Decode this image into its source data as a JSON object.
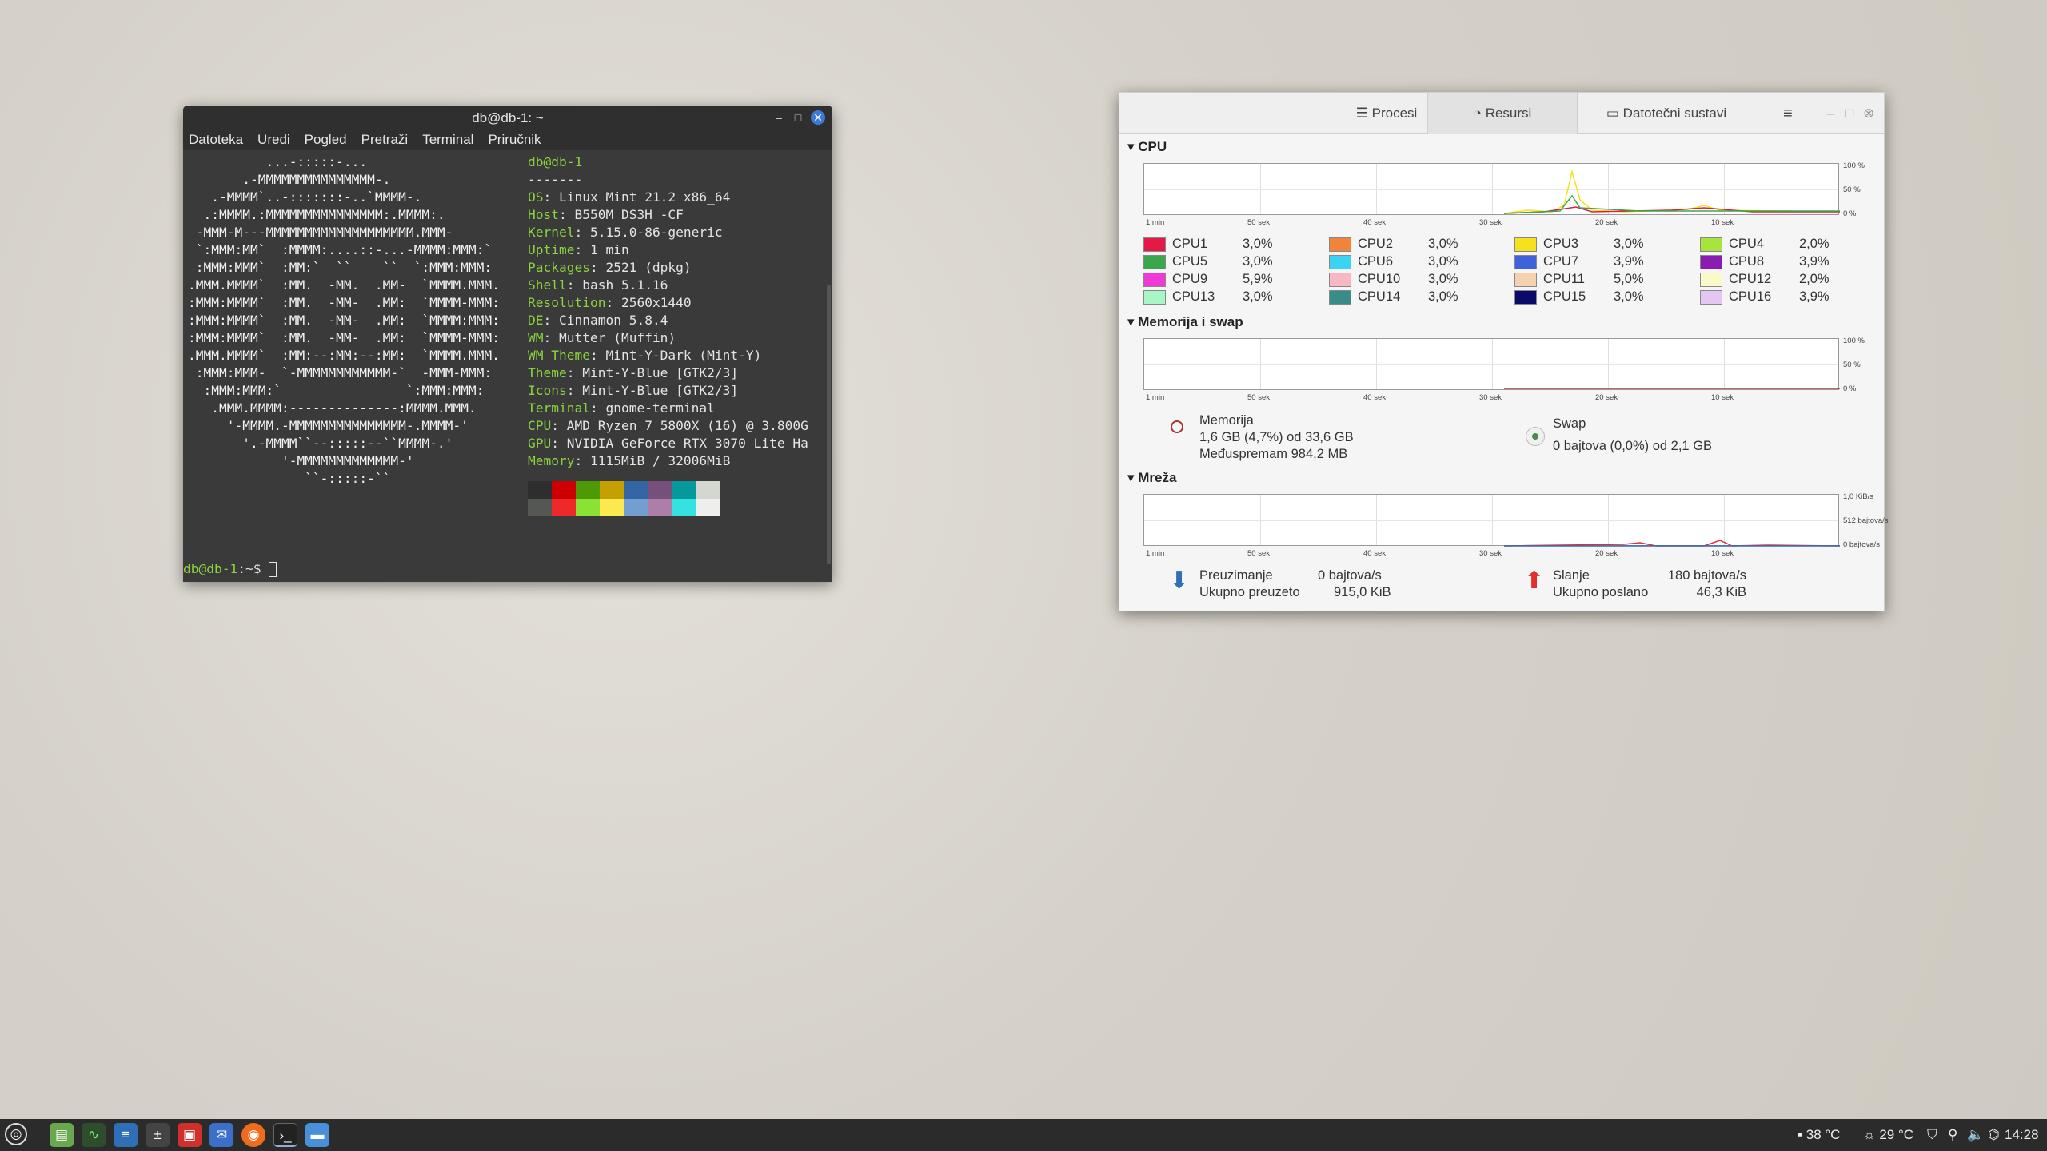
{
  "terminal": {
    "title": "db@db-1: ~",
    "menu": [
      "Datoteka",
      "Uredi",
      "Pogled",
      "Pretraži",
      "Terminal",
      "Priručnik"
    ],
    "ascii_art": [
      "          ...-:::::-...",
      "       .-MMMMMMMMMMMMMMM-.",
      "   .-MMMM`..-:::::::-..`MMMM-.",
      "  .:MMMM.:MMMMMMMMMMMMMMM:.MMMM:.",
      " -MMM-M---MMMMMMMMMMMMMMMMMMM.MMM-",
      " `:MMM:MM`  :MMMM:....::-...-MMMM:MMM:`",
      " :MMM:MMM`  :MM:`  ``    ``  `:MMM:MMM:",
      ".MMM.MMMM`  :MM.  -MM.  .MM-  `MMMM.MMM.",
      ":MMM:MMMM`  :MM.  -MM-  .MM:  `MMMM-MMM:",
      ":MMM:MMMM`  :MM.  -MM-  .MM:  `MMMM:MMM:",
      ":MMM:MMMM`  :MM.  -MM-  .MM:  `MMMM-MMM:",
      ".MMM.MMMM`  :MM:--:MM:--:MM:  `MMMM.MMM.",
      " :MMM:MMM-  `-MMMMMMMMMMMM-`  -MMM-MMM:",
      "  :MMM:MMM:`                `:MMM:MMM:",
      "   .MMM.MMMM:--------------:MMMM.MMM.",
      "     '-MMMM.-MMMMMMMMMMMMMMM-.MMMM-'",
      "       '.-MMMM``--:::::--``MMMM-.'",
      "            '-MMMMMMMMMMMMM-'",
      "               ``-:::::-``"
    ],
    "user_host": "db@db-1",
    "separator": "-------",
    "info": [
      {
        "k": "OS",
        "v": "Linux Mint 21.2 x86_64"
      },
      {
        "k": "Host",
        "v": "B550M DS3H -CF"
      },
      {
        "k": "Kernel",
        "v": "5.15.0-86-generic"
      },
      {
        "k": "Uptime",
        "v": "1 min"
      },
      {
        "k": "Packages",
        "v": "2521 (dpkg)"
      },
      {
        "k": "Shell",
        "v": "bash 5.1.16"
      },
      {
        "k": "Resolution",
        "v": "2560x1440"
      },
      {
        "k": "DE",
        "v": "Cinnamon 5.8.4"
      },
      {
        "k": "WM",
        "v": "Mutter (Muffin)"
      },
      {
        "k": "WM Theme",
        "v": "Mint-Y-Dark (Mint-Y)"
      },
      {
        "k": "Theme",
        "v": "Mint-Y-Blue [GTK2/3]"
      },
      {
        "k": "Icons",
        "v": "Mint-Y-Blue [GTK2/3]"
      },
      {
        "k": "Terminal",
        "v": "gnome-terminal"
      },
      {
        "k": "CPU",
        "v": "AMD Ryzen 7 5800X (16) @ 3.800G"
      },
      {
        "k": "GPU",
        "v": "NVIDIA GeForce RTX 3070 Lite Ha"
      },
      {
        "k": "Memory",
        "v": "1115MiB / 32006MiB"
      }
    ],
    "palette_top": [
      "#2e2e2e",
      "#cc0000",
      "#4e9a06",
      "#c4a000",
      "#3465a4",
      "#75507b",
      "#06989a",
      "#d3d7cf"
    ],
    "palette_bottom": [
      "#555753",
      "#ef2929",
      "#8ae234",
      "#fce94f",
      "#729fcf",
      "#ad7fa8",
      "#34e2e2",
      "#eeeeec"
    ],
    "prompt_user": "db@db-1",
    "prompt_rest": ":~$ "
  },
  "monitor": {
    "tabs": [
      "Procesi",
      "Resursi",
      "Datotečni sustavi"
    ],
    "cpu_title": "CPU",
    "mem_title": "Memorija i swap",
    "net_title": "Mreža",
    "time_ticks": [
      "1 min",
      "50 sek",
      "40 sek",
      "30 sek",
      "20 sek",
      "10 sek"
    ],
    "pct_ticks": [
      "100 %",
      "50 %",
      "0 %"
    ],
    "net_ticks": [
      "1,0 KiB/s",
      "512 bajtova/s",
      "0 bajtova/s"
    ],
    "cpus": [
      {
        "name": "CPU1",
        "pct": "3,0%",
        "color": "#e31a47"
      },
      {
        "name": "CPU2",
        "pct": "3,0%",
        "color": "#f0843a"
      },
      {
        "name": "CPU3",
        "pct": "3,0%",
        "color": "#f6e11d"
      },
      {
        "name": "CPU4",
        "pct": "2,0%",
        "color": "#a8e43e"
      },
      {
        "name": "CPU5",
        "pct": "3,0%",
        "color": "#3aa84a"
      },
      {
        "name": "CPU6",
        "pct": "3,0%",
        "color": "#3ad3f0"
      },
      {
        "name": "CPU7",
        "pct": "3,9%",
        "color": "#3d62dc"
      },
      {
        "name": "CPU8",
        "pct": "3,9%",
        "color": "#8b1cb0"
      },
      {
        "name": "CPU9",
        "pct": "5,9%",
        "color": "#f03ad8"
      },
      {
        "name": "CPU10",
        "pct": "3,0%",
        "color": "#f7b8c4"
      },
      {
        "name": "CPU11",
        "pct": "5,0%",
        "color": "#f6d1b0"
      },
      {
        "name": "CPU12",
        "pct": "2,0%",
        "color": "#fafac8"
      },
      {
        "name": "CPU13",
        "pct": "3,0%",
        "color": "#a8f5c6"
      },
      {
        "name": "CPU14",
        "pct": "3,0%",
        "color": "#3a8c8a"
      },
      {
        "name": "CPU15",
        "pct": "3,0%",
        "color": "#0a0a6a"
      },
      {
        "name": "CPU16",
        "pct": "3,9%",
        "color": "#e4c6f3"
      }
    ],
    "memory": {
      "label": "Memorija",
      "used": "1,6 GB (4,7%) od 33,6 GB",
      "cache": "Međuspremam 984,2 MB"
    },
    "swap": {
      "label": "Swap",
      "used": "0 bajtova (0,0%) od 2,1 GB"
    },
    "net": {
      "down_label": "Preuzimanje",
      "down_rate": "0 bajtova/s",
      "down_total_label": "Ukupno preuzeto",
      "down_total": "915,0 KiB",
      "up_label": "Slanje",
      "up_rate": "180 bajtova/s",
      "up_total_label": "Ukupno poslano",
      "up_total": "46,3 KiB"
    }
  },
  "panel": {
    "apps": [
      "menu-icon",
      "software-icon",
      "system-monitor-icon",
      "text-editor-icon",
      "calculator-icon",
      "document-viewer-icon",
      "mail-icon",
      "firefox-icon",
      "terminal-icon",
      "files-icon"
    ],
    "temp1": "38 °C",
    "temp2": "29 °C",
    "clock": "14:28"
  }
}
